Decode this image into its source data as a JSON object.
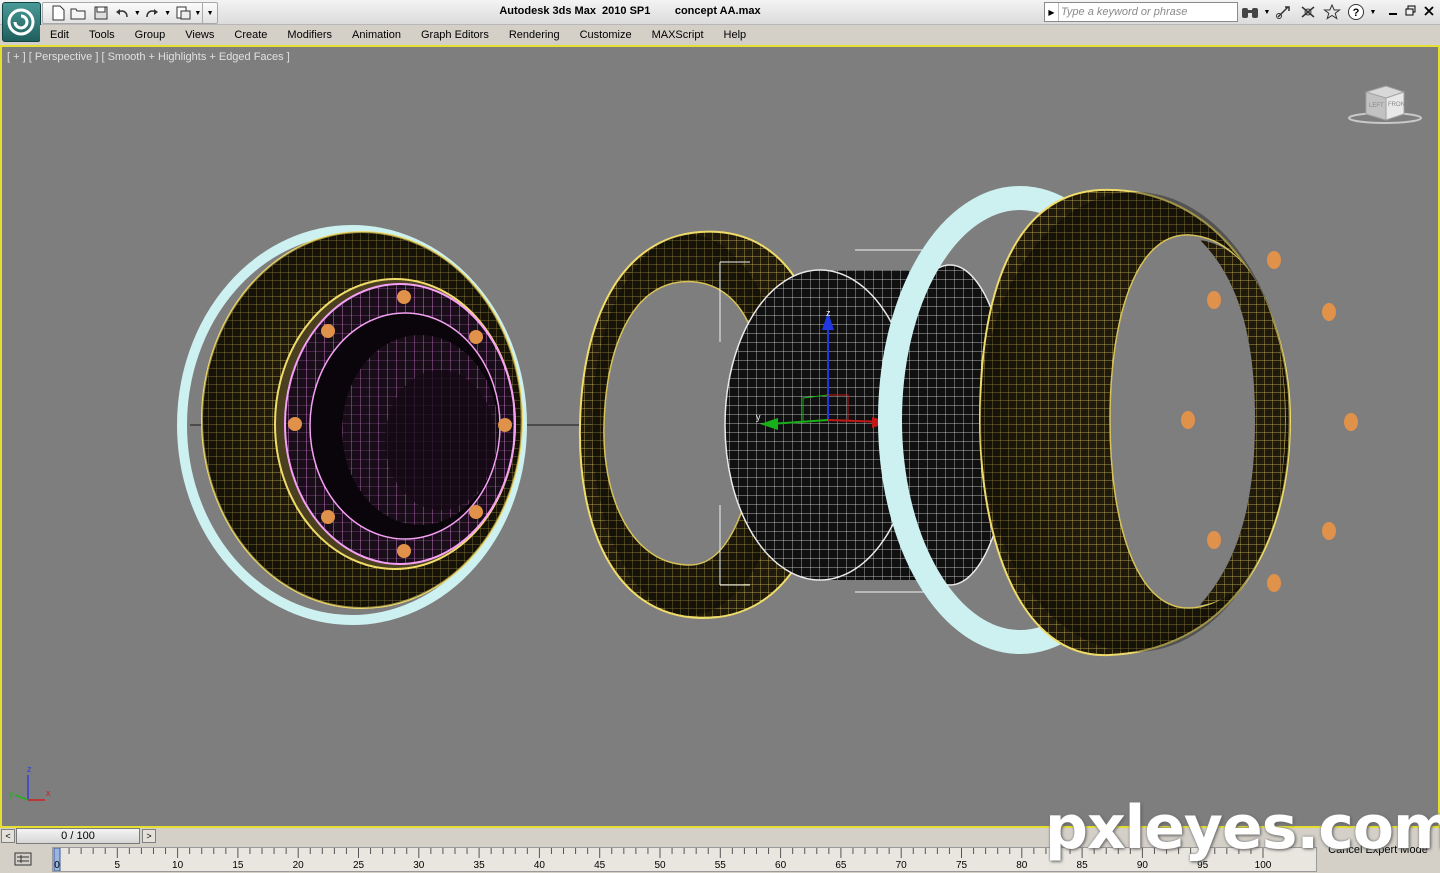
{
  "app": {
    "title": "Autodesk 3ds Max  2010 SP1",
    "file": "concept AA.max"
  },
  "search": {
    "placeholder": "Type a keyword or phrase"
  },
  "menu": [
    "Edit",
    "Tools",
    "Group",
    "Views",
    "Create",
    "Modifiers",
    "Animation",
    "Graph Editors",
    "Rendering",
    "Customize",
    "MAXScript",
    "Help"
  ],
  "viewport": {
    "label": "[ + ] [ Perspective ] [ Smooth + Highlights + Edged Faces ]",
    "viewcube_faces": [
      "LEFT",
      "FRONT"
    ],
    "axis_labels": {
      "z": "z",
      "y": "y",
      "x": "x"
    },
    "gizmo_labels": {
      "z": "z",
      "y": "y",
      "x": "x"
    }
  },
  "time_slider": {
    "position": "0 / 100",
    "prev": "<",
    "next": ">"
  },
  "timeline": {
    "ticks": [
      "0",
      "5",
      "10",
      "15",
      "20",
      "25",
      "30",
      "35",
      "40",
      "45",
      "50",
      "55",
      "60",
      "65",
      "70",
      "75",
      "80",
      "85",
      "90",
      "95",
      "100"
    ],
    "cancel_expert": "Cancel Expert Mode"
  },
  "watermark": "pxleyes.com",
  "colors": {
    "viewport_bg": "#7e7e7e",
    "active_border": "#e5df31",
    "wire_yellow": "#e8d25a",
    "ring_cyan": "#cdf1f0",
    "wire_pink": "#f28ff0",
    "bolt_orange": "#e0914a"
  }
}
